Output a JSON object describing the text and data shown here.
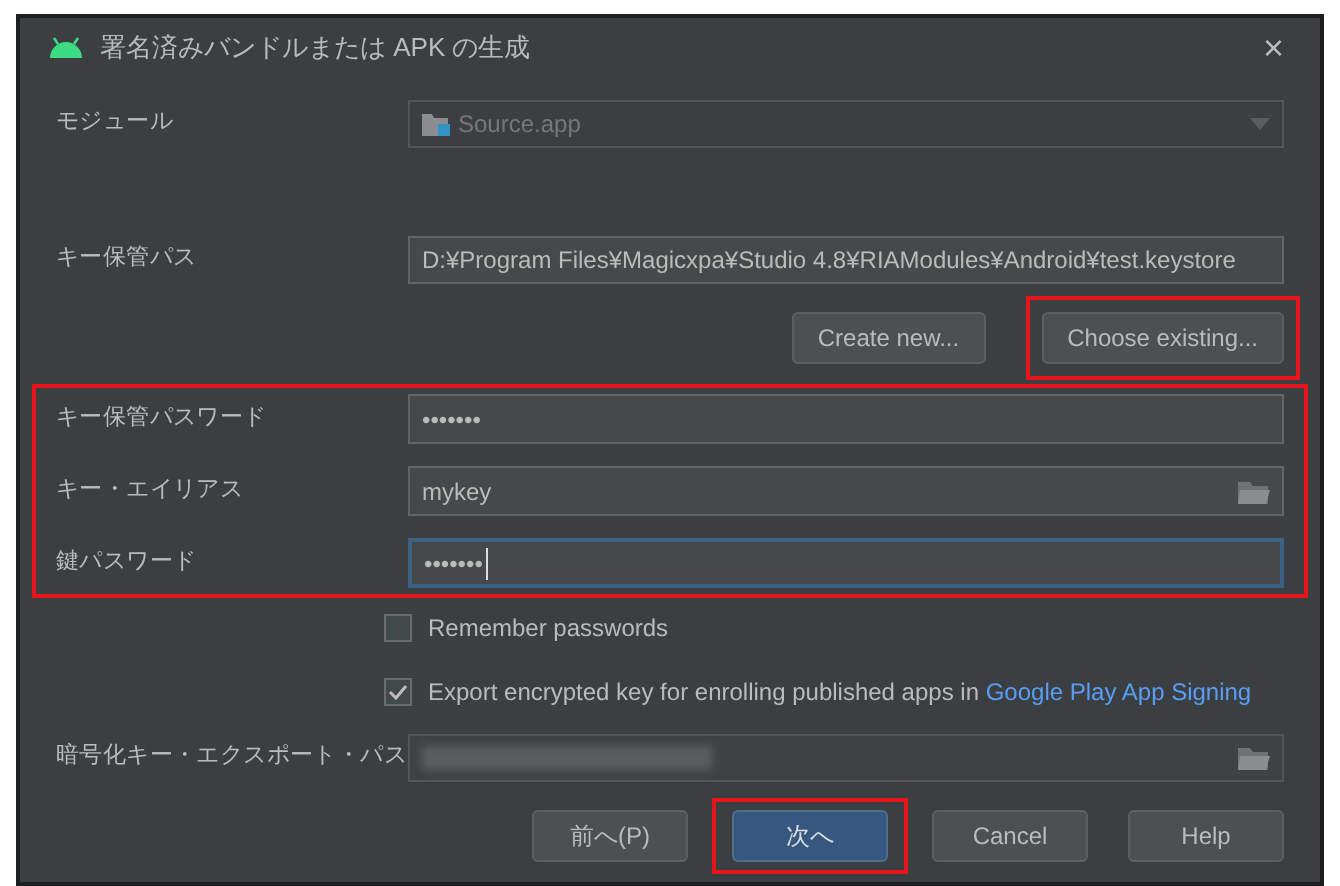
{
  "window": {
    "title": "署名済みバンドルまたは APK の生成",
    "close": "×"
  },
  "module": {
    "label": "モジュール",
    "value": "Source.app",
    "disabled": true
  },
  "keystore_path": {
    "label": "キー保管パス",
    "value": "D:¥Program Files¥Magicxpa¥Studio 4.8¥RIAModules¥Android¥test.keystore"
  },
  "keystore_buttons": [
    {
      "label": "Create new...",
      "highlighted": false
    },
    {
      "label": "Choose existing...",
      "highlighted": true
    }
  ],
  "credentials": {
    "highlighted": true,
    "fields": [
      {
        "label": "キー保管パスワード",
        "value": "•••••••",
        "kind": "password",
        "focused": false
      },
      {
        "label": "キー・エイリアス",
        "value": "mykey",
        "kind": "browse",
        "focused": false
      },
      {
        "label": "鍵パスワード",
        "value": "•••••••",
        "kind": "password",
        "focused": true
      }
    ]
  },
  "options": [
    {
      "label": "Remember passwords",
      "checked": false
    },
    {
      "label": "Export encrypted key for enrolling published apps in",
      "link": "Google Play App Signing",
      "checked": true
    }
  ],
  "export_path": {
    "label": "暗号化キー・エクスポート・パス",
    "redacted": true
  },
  "buttons": [
    {
      "label": "前へ(P)",
      "primary": false,
      "highlighted": false
    },
    {
      "label": "次へ",
      "primary": true,
      "highlighted": true
    },
    {
      "label": "Cancel",
      "primary": false,
      "highlighted": false
    },
    {
      "label": "Help",
      "primary": false,
      "highlighted": false
    }
  ]
}
